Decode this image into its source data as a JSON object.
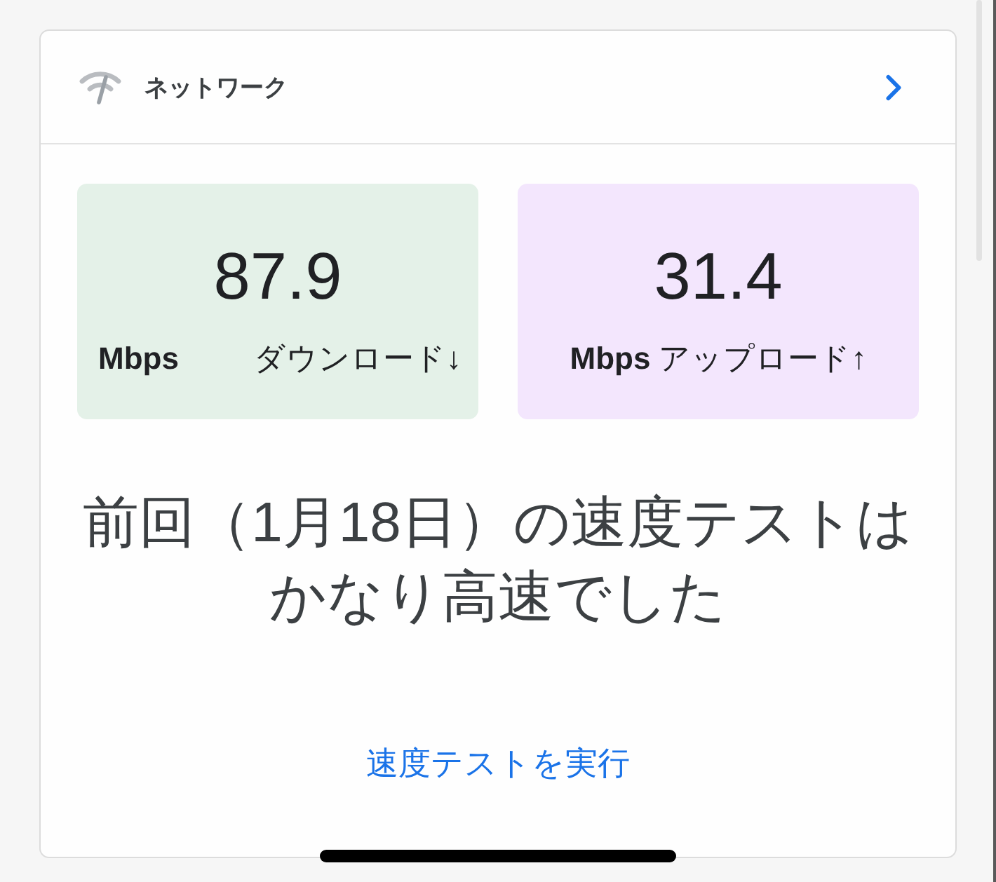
{
  "header": {
    "title": "ネットワーク"
  },
  "speed_tiles": [
    {
      "kind": "spread",
      "color": "#e4f1e8",
      "value": "87.9",
      "unit": "Mbps",
      "label": "ダウンロード↓"
    },
    {
      "kind": "inline",
      "color": "#f3e6fd",
      "value": "31.4",
      "unit": "Mbps",
      "label": "アップロード↑"
    }
  ],
  "message": "前回（1月18日）の速度テストはかなり高速でした",
  "action_link": "速度テストを実行"
}
